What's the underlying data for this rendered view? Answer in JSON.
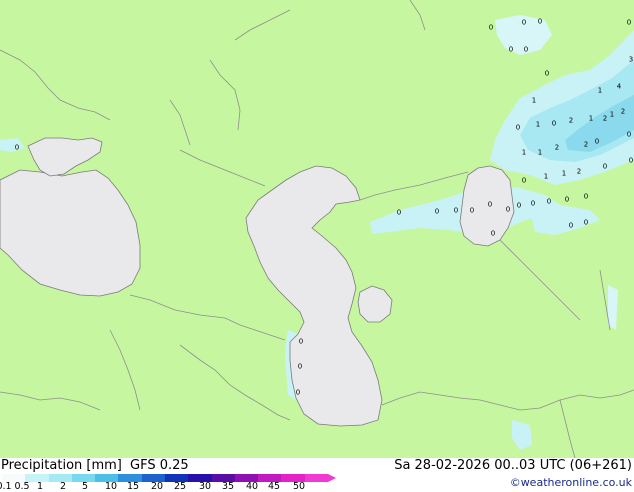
{
  "colors": {
    "land": "#c6f7a0",
    "water": "#e9e9ec",
    "border": "#8e8e8e",
    "coast": "#7a7a7a",
    "precip_light": "#c9f2f6",
    "precip_medium": "#a7e8f2",
    "precip_heavy": "#8ad9ec"
  },
  "footer": {
    "title_parts": [
      "Precipitation [mm]",
      "GFS 0.25"
    ],
    "datetime": "Sa 28-02-2026 00..03 UTC (06+261)",
    "credit": "©weatheronline.co.uk"
  },
  "legend": {
    "tick_labels": [
      "0.1",
      "0.5",
      "1",
      "2",
      "5",
      "10",
      "15",
      "20",
      "25",
      "30",
      "35",
      "40",
      "45",
      "50"
    ],
    "colors": [
      "#f8fbfc",
      "#c6f3f7",
      "#a6e8f4",
      "#78d9ef",
      "#4cbfe6",
      "#2d90dc",
      "#1b62cd",
      "#1033b8",
      "#2811a9",
      "#5a0ca6",
      "#8e12b3",
      "#c21ac1",
      "#e322c8",
      "#f03ad2"
    ]
  },
  "map_labels": [
    {
      "t": "0"
    },
    {
      "t": "0"
    },
    {
      "t": "0"
    },
    {
      "t": "0"
    },
    {
      "t": "0"
    },
    {
      "t": "0"
    },
    {
      "t": "0"
    },
    {
      "t": "1"
    },
    {
      "t": "3"
    },
    {
      "t": "1"
    },
    {
      "t": "4"
    },
    {
      "t": "1"
    },
    {
      "t": "0"
    },
    {
      "t": "1"
    },
    {
      "t": "0"
    },
    {
      "t": "2"
    },
    {
      "t": "2"
    },
    {
      "t": "1"
    },
    {
      "t": "2"
    },
    {
      "t": "0"
    },
    {
      "t": "1"
    },
    {
      "t": "1"
    },
    {
      "t": "2"
    },
    {
      "t": "2"
    },
    {
      "t": "0"
    },
    {
      "t": "0"
    },
    {
      "t": "0"
    },
    {
      "t": "1"
    },
    {
      "t": "1"
    },
    {
      "t": "2"
    },
    {
      "t": "0"
    },
    {
      "t": "0"
    },
    {
      "t": "0"
    },
    {
      "t": "0"
    },
    {
      "t": "0"
    },
    {
      "t": "0"
    },
    {
      "t": "0"
    },
    {
      "t": "0"
    },
    {
      "t": "0"
    },
    {
      "t": "0"
    },
    {
      "t": "0"
    },
    {
      "t": "0"
    },
    {
      "t": "0"
    },
    {
      "t": "0"
    },
    {
      "t": "0"
    },
    {
      "t": "0"
    },
    {
      "t": "0"
    }
  ]
}
